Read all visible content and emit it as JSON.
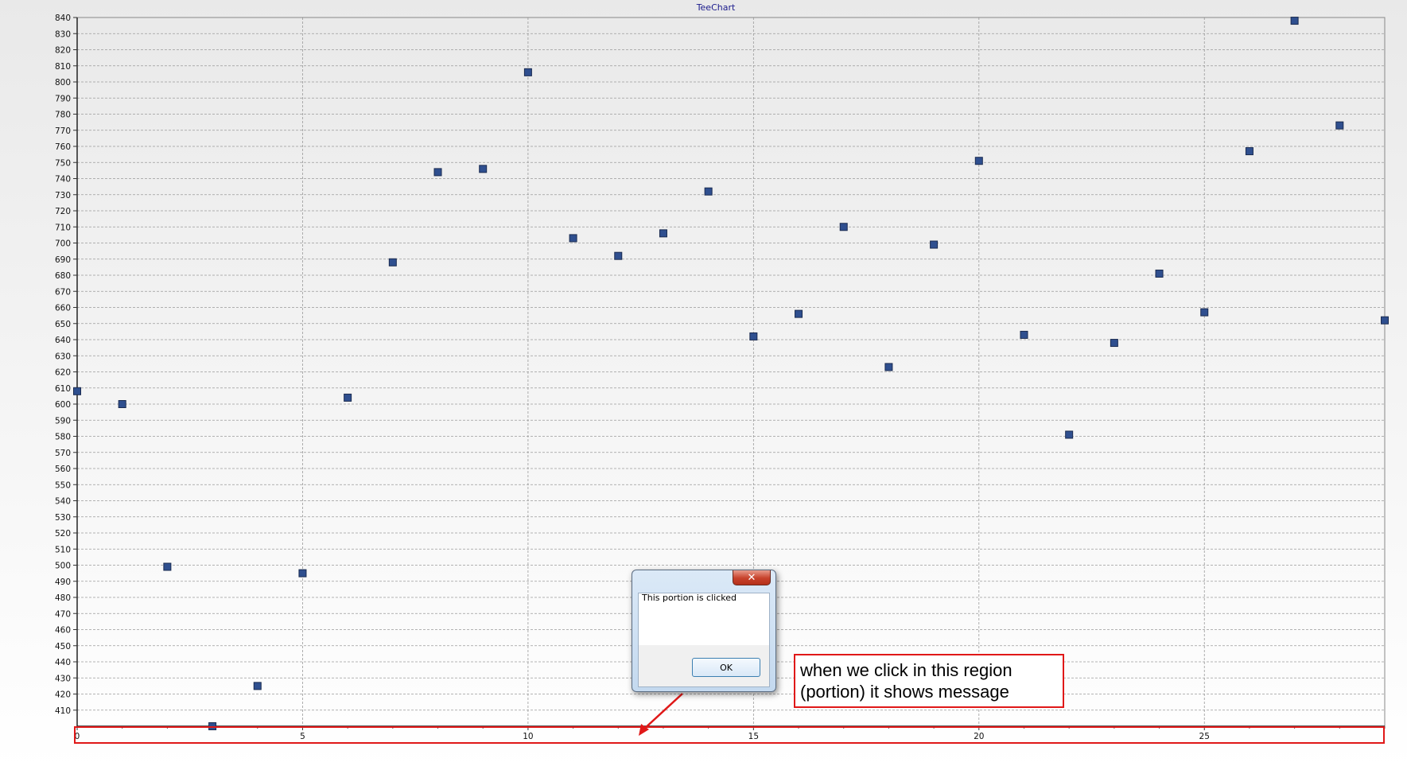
{
  "chart_data": {
    "type": "scatter",
    "title": "TeeChart",
    "xlabel": "",
    "ylabel": "",
    "xlim": [
      0,
      29
    ],
    "ylim": [
      400,
      840
    ],
    "xticks": [
      0,
      5,
      10,
      15,
      20,
      25
    ],
    "yticks": [
      410,
      420,
      430,
      440,
      450,
      460,
      470,
      480,
      490,
      500,
      510,
      520,
      530,
      540,
      550,
      560,
      570,
      580,
      590,
      600,
      610,
      620,
      630,
      640,
      650,
      660,
      670,
      680,
      690,
      700,
      710,
      720,
      730,
      740,
      750,
      760,
      770,
      780,
      790,
      800,
      810,
      820,
      830,
      840
    ],
    "grid": true,
    "legend": "none",
    "marker": "square",
    "marker_color": "#2f4f8f",
    "x": [
      0,
      1,
      2,
      3,
      4,
      5,
      6,
      7,
      8,
      9,
      10,
      11,
      12,
      13,
      14,
      15,
      16,
      17,
      18,
      19,
      20,
      21,
      22,
      23,
      24,
      25,
      26,
      27,
      28,
      29
    ],
    "y": [
      608,
      600,
      499,
      400,
      425,
      495,
      604,
      688,
      744,
      746,
      806,
      703,
      692,
      706,
      732,
      642,
      656,
      710,
      623,
      699,
      751,
      643,
      581,
      638,
      681,
      657,
      757,
      838,
      773,
      652
    ]
  },
  "dialog": {
    "close_label": "✕",
    "message": "This portion is clicked",
    "ok_label": "OK"
  },
  "annotation": {
    "line1": "when we click in this region",
    "line2": "(portion) it shows message",
    "color": "#e01818"
  }
}
